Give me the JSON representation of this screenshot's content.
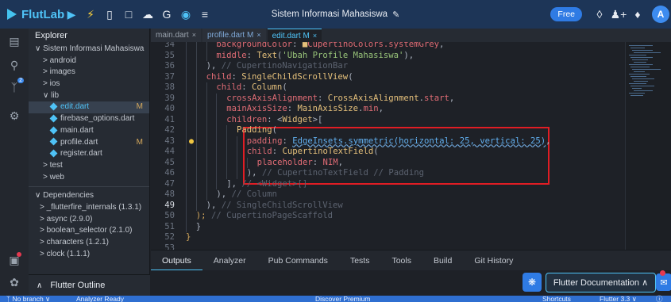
{
  "app": {
    "name": "FlutLab",
    "project_title": "Sistem Informasi Mahasiswa",
    "plan_badge": "Free",
    "avatar_letter": "A"
  },
  "toolbar": {
    "icons": [
      "run-icon",
      "hot-reload-icon",
      "device-icon",
      "save-icon",
      "cloud-icon",
      "git-icon",
      "settings-icon",
      "menu-icon",
      "edit-icon",
      "layers-icon",
      "add-user-icon",
      "bell-icon"
    ]
  },
  "activity_bar": {
    "git_badge": "2"
  },
  "explorer": {
    "title": "Explorer",
    "rows": [
      {
        "label": "Sistem Informasi Mahasiswa",
        "prefix": "∨",
        "indent": 0
      },
      {
        "label": "android",
        "prefix": ">",
        "indent": 1
      },
      {
        "label": "images",
        "prefix": ">",
        "indent": 1
      },
      {
        "label": "ios",
        "prefix": ">",
        "indent": 1
      },
      {
        "label": "lib",
        "prefix": "∨",
        "indent": 1
      },
      {
        "label": "edit.dart",
        "prefix": "dart",
        "indent": 2,
        "status": "M",
        "selected": true
      },
      {
        "label": "firebase_options.dart",
        "prefix": "dart",
        "indent": 2
      },
      {
        "label": "main.dart",
        "prefix": "dart",
        "indent": 2
      },
      {
        "label": "profile.dart",
        "prefix": "dart",
        "indent": 2,
        "status": "M"
      },
      {
        "label": "register.dart",
        "prefix": "dart",
        "indent": 2
      },
      {
        "label": "test",
        "prefix": ">",
        "indent": 1
      },
      {
        "label": "web",
        "prefix": ">",
        "indent": 1
      }
    ],
    "dependencies_title": "Dependencies",
    "dependencies": [
      "_flutterfire_internals (1.3.1)",
      "async (2.9.0)",
      "boolean_selector (2.1.0)",
      "characters (1.2.1)",
      "clock (1.1.1)"
    ],
    "outline_label": "Flutter Outline"
  },
  "tabs": [
    {
      "label": "main.dart",
      "close": "×",
      "state": "normal"
    },
    {
      "label": "profile.dart M",
      "close": "×",
      "state": "modified"
    },
    {
      "label": "edit.dart M",
      "close": "×",
      "state": "active"
    }
  ],
  "editor": {
    "current_line": "49",
    "lines": [
      {
        "n": "34",
        "indent": 3,
        "tokens": [
          [
            "id",
            "backgroundColor"
          ],
          [
            "pun",
            ": "
          ],
          [
            "ty",
            "■"
          ],
          [
            "id",
            "CupertinoColors.systemGrey"
          ],
          [
            "pun",
            ","
          ]
        ]
      },
      {
        "n": "35",
        "indent": 3,
        "tokens": [
          [
            "id",
            "middle"
          ],
          [
            "pun",
            ": "
          ],
          [
            "ty",
            "Text"
          ],
          [
            "pun",
            "("
          ],
          [
            "str",
            "'Ubah Profile Mahasiswa'"
          ],
          [
            "pun",
            "),"
          ]
        ]
      },
      {
        "n": "36",
        "indent": 2,
        "tokens": [
          [
            "pun",
            "), "
          ],
          [
            "cmt",
            "// CupertinoNavigationBar"
          ]
        ]
      },
      {
        "n": "37",
        "indent": 2,
        "tokens": [
          [
            "id",
            "child"
          ],
          [
            "pun",
            ": "
          ],
          [
            "ty",
            "SingleChildScrollView"
          ],
          [
            "pun",
            "("
          ]
        ]
      },
      {
        "n": "38",
        "indent": 3,
        "tokens": [
          [
            "id",
            "child"
          ],
          [
            "pun",
            ": "
          ],
          [
            "ty",
            "Column"
          ],
          [
            "pun",
            "("
          ]
        ]
      },
      {
        "n": "39",
        "indent": 4,
        "tokens": [
          [
            "id",
            "crossAxisAlignment"
          ],
          [
            "pun",
            ": "
          ],
          [
            "ty",
            "CrossAxisAlignment"
          ],
          [
            "pun",
            "."
          ],
          [
            "id",
            "start"
          ],
          [
            "pun",
            ","
          ]
        ]
      },
      {
        "n": "40",
        "indent": 4,
        "tokens": [
          [
            "id",
            "mainAxisSize"
          ],
          [
            "pun",
            ": "
          ],
          [
            "ty",
            "MainAxisSize"
          ],
          [
            "pun",
            "."
          ],
          [
            "id",
            "min"
          ],
          [
            "pun",
            ","
          ]
        ]
      },
      {
        "n": "41",
        "indent": 4,
        "tokens": [
          [
            "id",
            "children"
          ],
          [
            "pun",
            ": <"
          ],
          [
            "ty",
            "Widget"
          ],
          [
            "pun",
            ">["
          ]
        ]
      },
      {
        "n": "42",
        "indent": 5,
        "tokens": [
          [
            "ty",
            "Padding"
          ],
          [
            "pun",
            "("
          ]
        ]
      },
      {
        "n": "43",
        "indent": 6,
        "tokens": [
          [
            "id",
            "padding"
          ],
          [
            "pun",
            ": "
          ],
          [
            "sq",
            "EdgeInsets.symmetric(horizontal: 25, vertical: 25)"
          ],
          [
            "pun",
            ","
          ]
        ]
      },
      {
        "n": "44",
        "indent": 6,
        "tokens": [
          [
            "id",
            "child"
          ],
          [
            "pun",
            ": "
          ],
          [
            "ty",
            "CupertinoTextField"
          ],
          [
            "pun",
            "("
          ]
        ]
      },
      {
        "n": "45",
        "indent": 7,
        "tokens": [
          [
            "id",
            "placeholder"
          ],
          [
            "pun",
            ": "
          ],
          [
            "id",
            "NIM"
          ],
          [
            "pun",
            ","
          ]
        ]
      },
      {
        "n": "46",
        "indent": 6,
        "tokens": [
          [
            "pun",
            "), "
          ],
          [
            "cmt",
            "// CupertinoTextField // Padding"
          ]
        ]
      },
      {
        "n": "47",
        "indent": 4,
        "tokens": [
          [
            "pun",
            "], "
          ],
          [
            "cmt",
            "// <Widget>[]"
          ]
        ]
      },
      {
        "n": "48",
        "indent": 3,
        "tokens": [
          [
            "pun",
            "), "
          ],
          [
            "cmt",
            "// Column"
          ]
        ]
      },
      {
        "n": "49",
        "indent": 2,
        "tokens": [
          [
            "pun",
            "), "
          ],
          [
            "cmt",
            "// SingleChildScrollView"
          ]
        ]
      },
      {
        "n": "50",
        "indent": 1,
        "tokens": [
          [
            "br",
            "); "
          ],
          [
            "cmt",
            "// CupertinoPageScaffold"
          ]
        ]
      },
      {
        "n": "51",
        "indent": 1,
        "tokens": [
          [
            "pun",
            "}"
          ]
        ]
      },
      {
        "n": "52",
        "indent": 0,
        "tokens": [
          [
            "br",
            "}"
          ]
        ]
      },
      {
        "n": "53",
        "indent": 0,
        "tokens": []
      }
    ]
  },
  "panel": {
    "tabs": [
      "Outputs",
      "Analyzer",
      "Pub Commands",
      "Tests",
      "Tools",
      "Build",
      "Git History"
    ],
    "active_tab": "Outputs",
    "flutter_docs_label": "Flutter Documentation ∧"
  },
  "statusbar": {
    "branch": "No branch ∨",
    "analyzer": "Analyzer Ready",
    "promo": "Discover Premium",
    "shortcuts": "Shortcuts",
    "flutter_version": "Flutter 3.3 ∨"
  },
  "colors": {
    "topbar": "#1d3557",
    "accent": "#4fc3f7",
    "highlight_box": "#e01d24",
    "statusbar": "#2f6fd1"
  }
}
